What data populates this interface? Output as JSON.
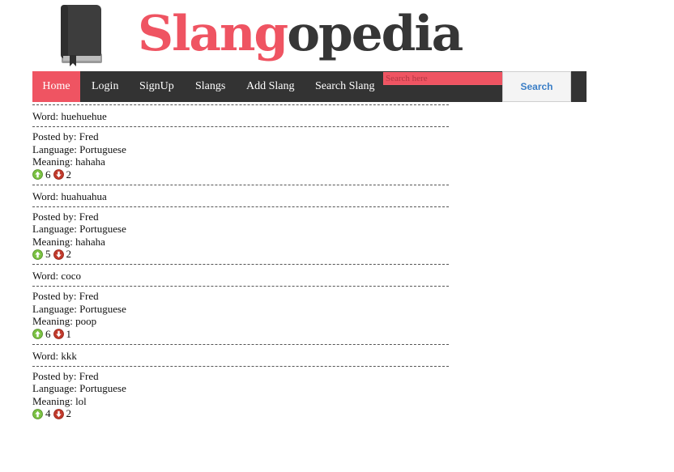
{
  "header": {
    "logo_accent": "Slang",
    "logo_rest": "opedia",
    "accent_color": "#ef5462",
    "logo_text_color": "#363636",
    "logo_icon": "book-icon"
  },
  "nav": {
    "bar_color": "#333333",
    "items": [
      {
        "label": "Home",
        "active": true
      },
      {
        "label": "Login",
        "active": false
      },
      {
        "label": "SignUp",
        "active": false
      },
      {
        "label": "Slangs",
        "active": false
      },
      {
        "label": "Add Slang",
        "active": false
      },
      {
        "label": "Search Slang",
        "active": false
      }
    ],
    "search": {
      "placeholder": "Search here",
      "value": "",
      "button_label": "Search"
    }
  },
  "slangs": [
    {
      "word": "Word: huehuehue",
      "posted_by": "Posted by: Fred",
      "language": "Language: Portuguese",
      "meaning": "Meaning: hahaha",
      "upvotes": "6",
      "downvotes": "2"
    },
    {
      "word": "Word: huahuahua",
      "posted_by": "Posted by: Fred",
      "language": "Language: Portuguese",
      "meaning": "Meaning: hahaha",
      "upvotes": "5",
      "downvotes": "2"
    },
    {
      "word": "Word: coco",
      "posted_by": "Posted by: Fred",
      "language": "Language: Portuguese",
      "meaning": "Meaning: poop",
      "upvotes": "6",
      "downvotes": "1"
    },
    {
      "word": "Word: kkk",
      "posted_by": "Posted by: Fred",
      "language": "Language: Portuguese",
      "meaning": "Meaning: lol",
      "upvotes": "4",
      "downvotes": "2"
    }
  ],
  "icons": {
    "upvote": "upvote-arrow-icon",
    "downvote": "downvote-arrow-icon",
    "upvote_color": "#7ac142",
    "downvote_color": "#c0392b"
  }
}
